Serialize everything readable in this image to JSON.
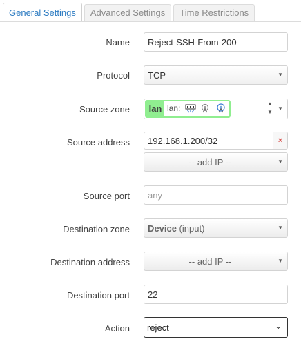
{
  "tabs": [
    {
      "label": "General Settings",
      "active": true
    },
    {
      "label": "Advanced Settings",
      "active": false
    },
    {
      "label": "Time Restrictions",
      "active": false
    }
  ],
  "form": {
    "name": {
      "label": "Name",
      "value": "Reject-SSH-From-200"
    },
    "protocol": {
      "label": "Protocol",
      "value": "TCP"
    },
    "source_zone": {
      "label": "Source zone",
      "zone": "lan",
      "sub": "lan:",
      "zone_color": "#90ee90"
    },
    "source_address": {
      "label": "Source address",
      "value": "192.168.1.200/32",
      "remove_label": "×",
      "add_label": "-- add IP --"
    },
    "source_port": {
      "label": "Source port",
      "placeholder": "any"
    },
    "destination_zone": {
      "label": "Destination zone",
      "name": "Device",
      "qualifier": "(input)"
    },
    "destination_address": {
      "label": "Destination address",
      "add_label": "-- add IP --"
    },
    "destination_port": {
      "label": "Destination port",
      "value": "22"
    },
    "action": {
      "label": "Action",
      "value": "reject"
    }
  },
  "colors": {
    "accent": "#2e7cc2",
    "zone_lan": "#90ee90",
    "remove": "#d9534f"
  }
}
